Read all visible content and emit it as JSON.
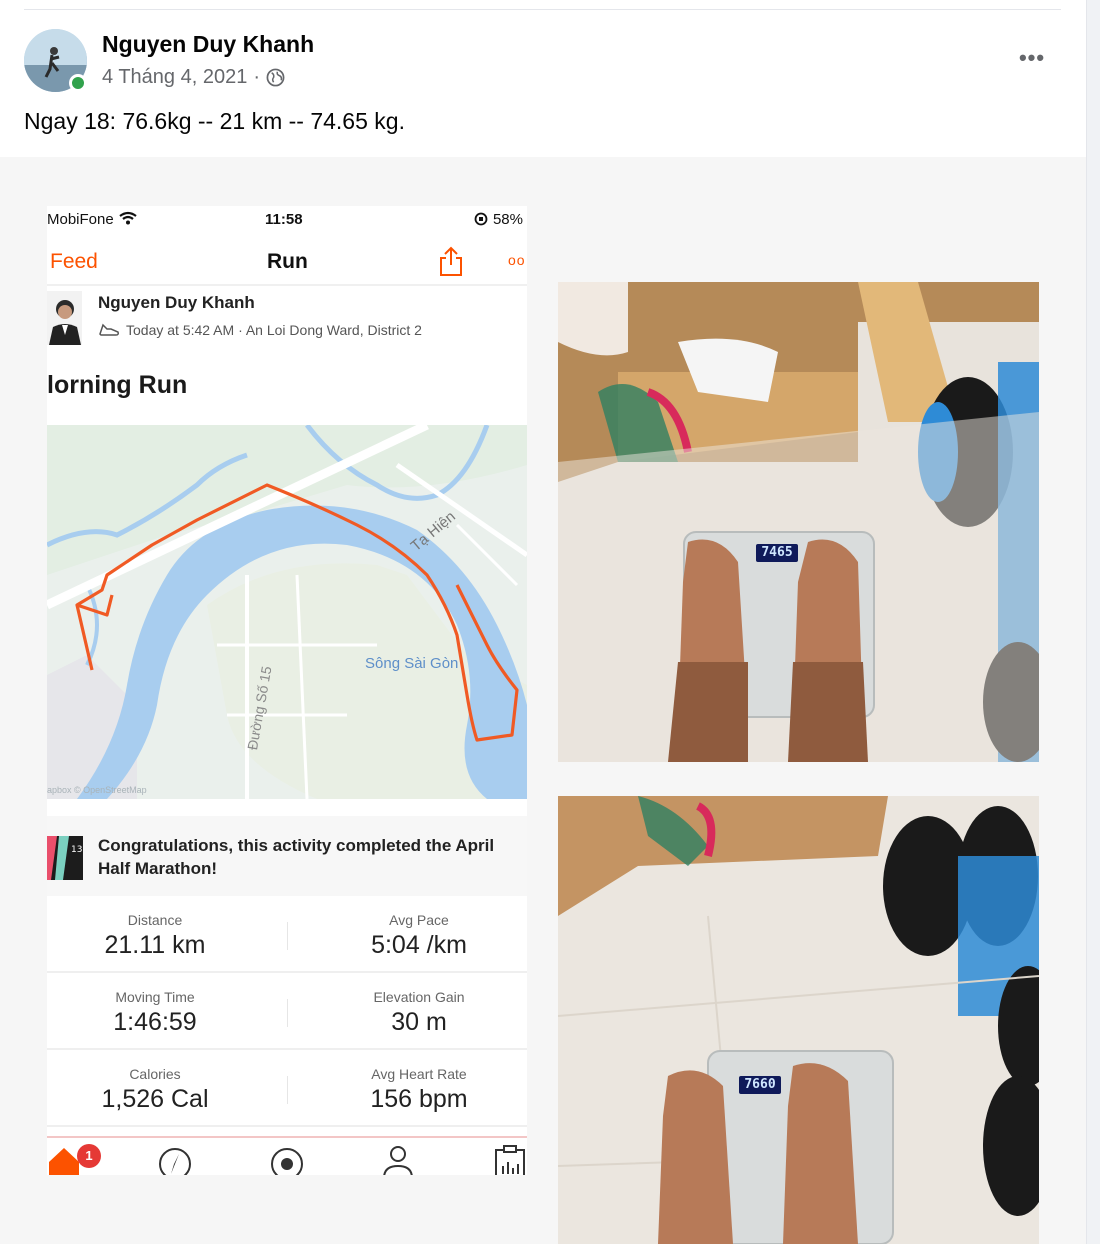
{
  "post": {
    "author": "Nguyen Duy Khanh",
    "date": "4 Tháng 4, 2021",
    "separator": "·",
    "text": "Ngay 18: 76.6kg -- 21 km -- 74.65 kg.",
    "more_label": "•••"
  },
  "strava": {
    "status_bar": {
      "carrier": "MobiFone",
      "time": "11:58",
      "battery": "58%"
    },
    "nav": {
      "back_label": "Feed",
      "title": "Run",
      "more_label": "oo"
    },
    "athlete": {
      "name": "Nguyen Duy Khanh",
      "meta": "Today at 5:42 AM · An Loi Dong Ward, District 2"
    },
    "activity_title": "lorning Run",
    "map_labels": {
      "street_1": "Tạ Hiện",
      "river": "Sông Sài Gòn",
      "street_2": "Đường Số 15",
      "attribution": "apbox © OpenStreetMap"
    },
    "achievement": "Congratulations, this activity completed the April Half Marathon!",
    "stats": [
      {
        "left_label": "Distance",
        "left_value": "21.11 km",
        "right_label": "Avg Pace",
        "right_value": "5:04 /km"
      },
      {
        "left_label": "Moving Time",
        "left_value": "1:46:59",
        "right_label": "Elevation Gain",
        "right_value": "30 m"
      },
      {
        "left_label": "Calories",
        "left_value": "1,526 Cal",
        "right_label": "Avg Heart Rate",
        "right_value": "156 bpm"
      }
    ],
    "tab_badge": "1"
  },
  "photos": {
    "scale_1_reading": "7465",
    "scale_2_reading": "7660"
  },
  "colors": {
    "strava_orange": "#fc5200",
    "online_green": "#31a24c",
    "route": "#f05a24"
  }
}
